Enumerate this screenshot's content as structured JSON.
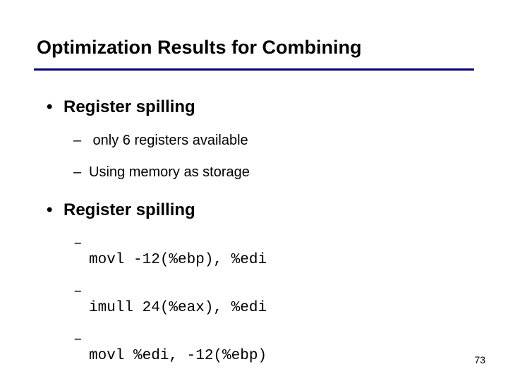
{
  "title": "Optimization Results for Combining",
  "bullet1": "Register spilling",
  "sub1a": " only 6 registers available",
  "sub1b": "Using memory as storage",
  "bullet2": "Register spilling",
  "code1": "movl -12(%ebp), %edi",
  "code2": "imull 24(%eax), %edi",
  "code3": "movl     %edi, -12(%ebp)",
  "page": "73"
}
